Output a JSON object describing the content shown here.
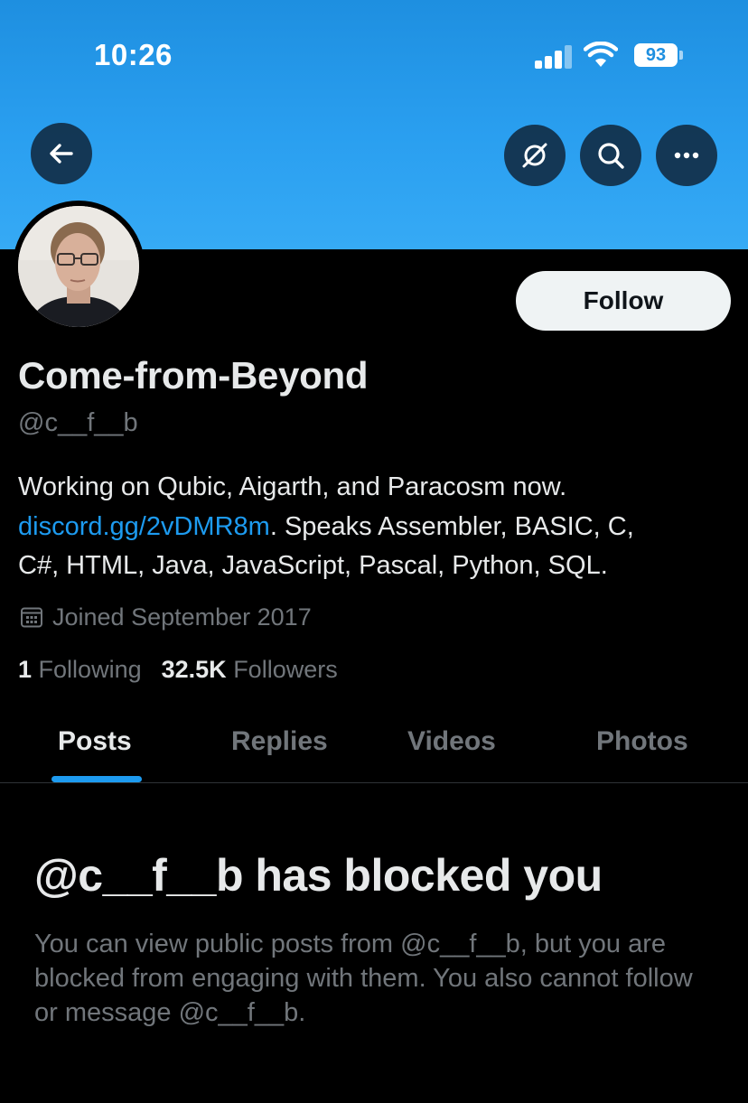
{
  "status_bar": {
    "time": "10:26",
    "battery": "93"
  },
  "header": {
    "back_icon": "arrow-left-icon",
    "grok_icon": "grok-slash-circle-icon",
    "search_icon": "search-icon",
    "more_icon": "more-horizontal-icon"
  },
  "profile": {
    "display_name": "Come-from-Beyond",
    "handle": "@c__f__b",
    "follow_label": "Follow",
    "bio_line1": "Working on Qubic, Aigarth, and Paracosm now.",
    "bio_link": "discord.gg/2vDMR8m",
    "bio_line2_rest": ". Speaks Assembler, BASIC, C,",
    "bio_line3": "C#, HTML, Java, JavaScript, Pascal, Python, SQL.",
    "joined": "Joined September 2017",
    "following_count": "1",
    "following_label": "Following",
    "followers_count": "32.5K",
    "followers_label": "Followers"
  },
  "tabs": [
    {
      "label": "Posts",
      "active": true
    },
    {
      "label": "Replies",
      "active": false
    },
    {
      "label": "Videos",
      "active": false
    },
    {
      "label": "Photos",
      "active": false
    }
  ],
  "blocked": {
    "title": "@c__f__b has blocked you",
    "description": "You can view public posts from @c__f__b, but you are blocked from engaging with them. You also cannot follow or message @c__f__b."
  },
  "colors": {
    "banner": "#2a9ff0",
    "accent": "#1d9bf0",
    "background": "#000000",
    "text_primary": "#e7e9ea",
    "text_secondary": "#71767b"
  }
}
